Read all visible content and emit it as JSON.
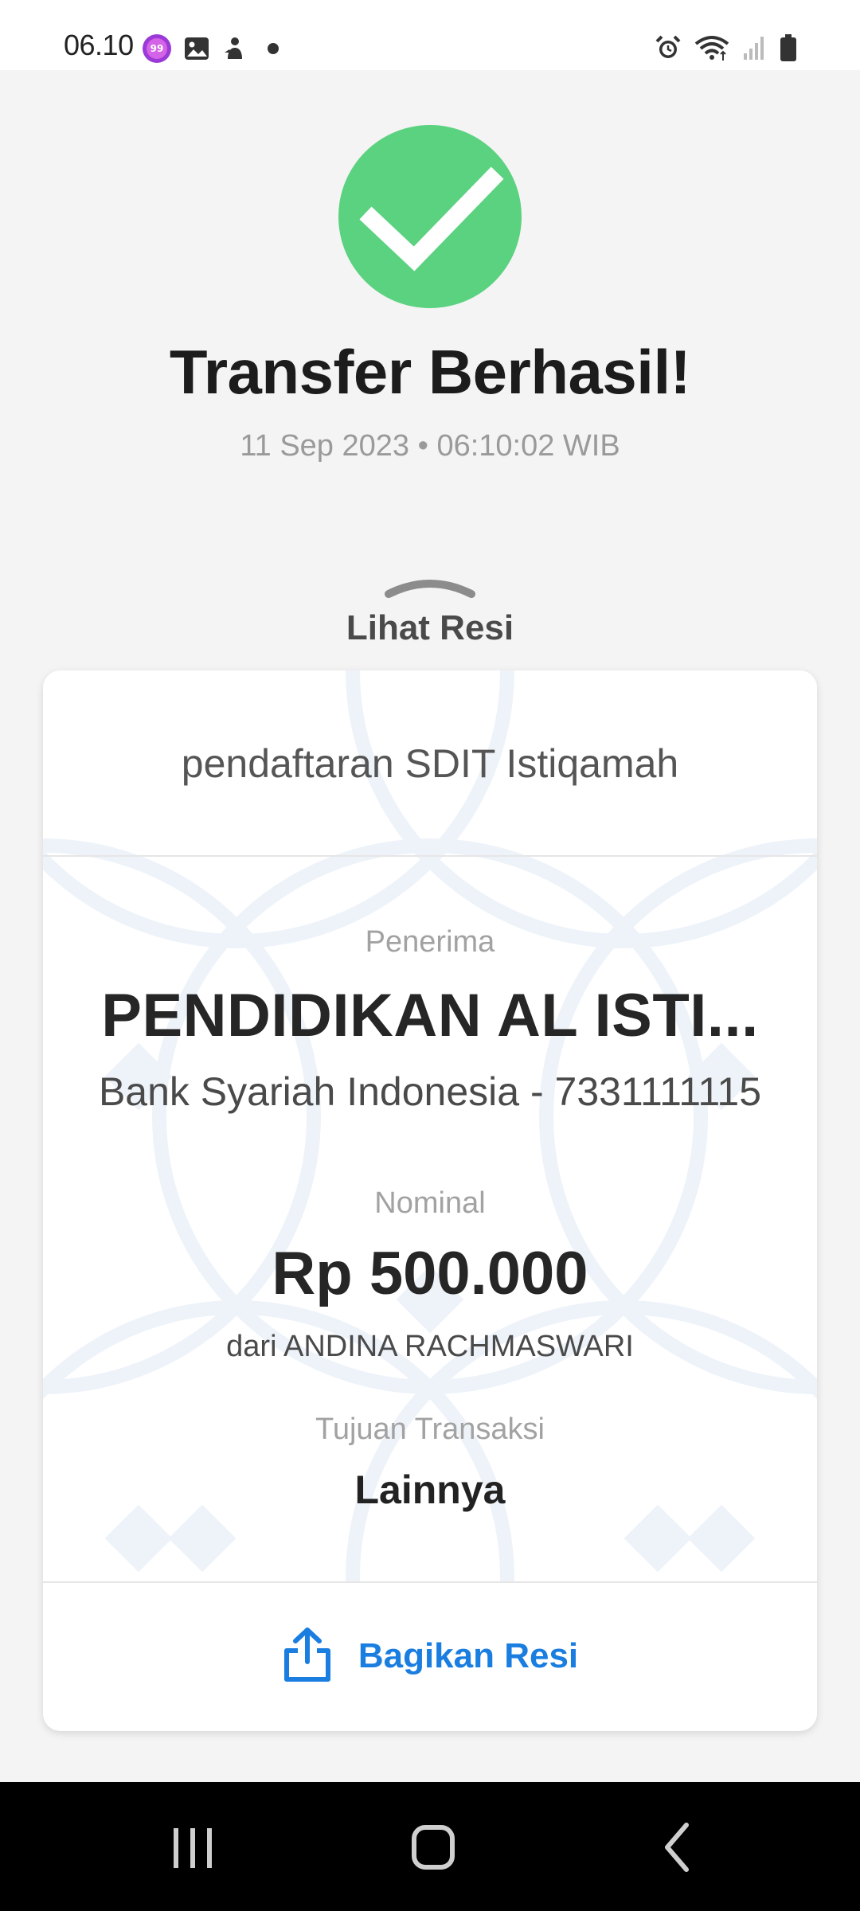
{
  "status_bar": {
    "time": "06.10",
    "left_icons": [
      "lazada-99-icon",
      "gallery-icon",
      "person-icon",
      "dot-icon"
    ],
    "right_icons": [
      "alarm-icon",
      "wifi-icon",
      "signal-icon",
      "battery-icon"
    ]
  },
  "result": {
    "title": "Transfer Berhasil!",
    "timestamp": "11 Sep 2023 • 06:10:02 WIB",
    "status_color": "#5ad27f"
  },
  "receipt_toggle": {
    "label": "Lihat Resi"
  },
  "receipt": {
    "note": "pendaftaran SDIT Istiqamah",
    "recipient_label": "Penerima",
    "recipient_name": "PENDIDIKAN AL ISTI...",
    "recipient_bank": "Bank Syariah Indonesia - 7331111115",
    "amount_label": "Nominal",
    "amount": "Rp 500.000",
    "sender": "dari ANDINA RACHMASWARI",
    "purpose_label": "Tujuan Transaksi",
    "purpose": "Lainnya",
    "share_label": "Bagikan Resi",
    "accent_color": "#1a7ee0"
  },
  "navigation": {
    "buttons": [
      "recents-icon",
      "home-icon",
      "back-icon"
    ]
  }
}
